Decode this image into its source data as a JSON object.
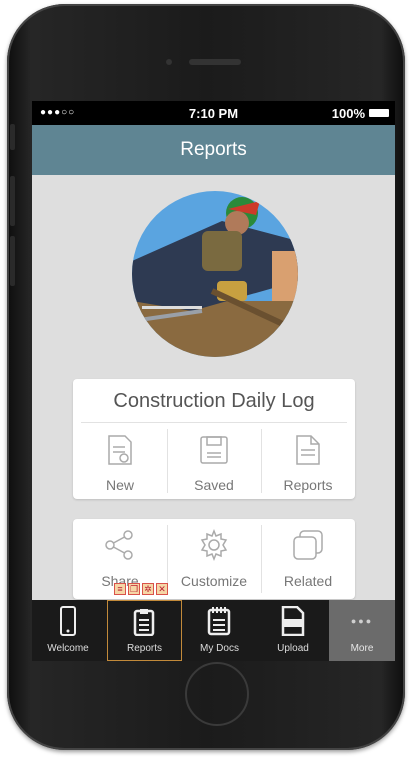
{
  "status_bar": {
    "signal": "●●●○○",
    "time": "7:10 PM",
    "battery": "100%"
  },
  "header": {
    "title": "Reports"
  },
  "log_card": {
    "title": "Construction Daily Log",
    "items": [
      {
        "label": "New",
        "icon": "new-document-icon"
      },
      {
        "label": "Saved",
        "icon": "save-icon"
      },
      {
        "label": "Reports",
        "icon": "document-icon"
      }
    ]
  },
  "actions_card": {
    "items": [
      {
        "label": "Share",
        "icon": "share-icon"
      },
      {
        "label": "Customize",
        "icon": "gear-icon"
      },
      {
        "label": "Related",
        "icon": "related-icon"
      }
    ]
  },
  "tab_bar": {
    "items": [
      {
        "label": "Welcome",
        "icon": "phone-icon"
      },
      {
        "label": "Reports",
        "icon": "clipboard-icon",
        "selected": true
      },
      {
        "label": "My Docs",
        "icon": "notepad-icon"
      },
      {
        "label": "Upload",
        "icon": "pdf-icon"
      },
      {
        "label": "More",
        "icon": "more-dots-icon"
      }
    ],
    "more_glyph": "●●●"
  },
  "colors": {
    "nav_bar": "#5f8593",
    "screen_bg": "#dedede",
    "tab_bar": "#1a1a1a",
    "more_tab": "#6b6b6b"
  }
}
